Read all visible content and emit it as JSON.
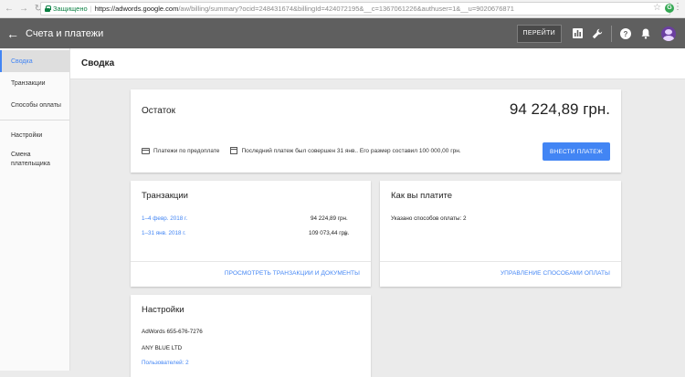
{
  "browser": {
    "secure_label": "Защищено",
    "url_host": "https://adwords.google.com",
    "url_path": "/aw/billing/summary?ocid=248431674&billingId=424072195&__c=1367061226&authuser=1&__u=9020676871",
    "extension_letter": "G"
  },
  "appbar": {
    "title": "Счета и платежи",
    "goto_label": "ПЕРЕЙТИ"
  },
  "sidebar": {
    "items": [
      {
        "label": "Сводка"
      },
      {
        "label": "Транзакции"
      },
      {
        "label": "Способы оплаты"
      },
      {
        "label": "Настройки"
      },
      {
        "label": "Смена плательщика"
      }
    ]
  },
  "page": {
    "title": "Сводка"
  },
  "balance": {
    "label": "Остаток",
    "amount": "94 224,89 грн.",
    "prepay_label": "Платежи по предоплате",
    "last_payment": "Последний платеж был совершен 31 янв.. Его размер составил 100 000,00 грн.",
    "pay_button": "ВНЕСТИ ПЛАТЕЖ"
  },
  "transactions": {
    "title": "Транзакции",
    "rows": [
      {
        "period": "1–4 февр. 2018 г.",
        "amount": "94 224,89 грн."
      },
      {
        "period": "1–31 янв. 2018 г.",
        "amount": "109 073,44 грн."
      }
    ],
    "link": "ПРОСМОТРЕТЬ ТРАНЗАКЦИИ И ДОКУМЕНТЫ"
  },
  "how_pay": {
    "title": "Как вы платите",
    "text": "Указано способов оплаты: 2",
    "link": "УПРАВЛЕНИЕ СПОСОБАМИ ОПЛАТЫ"
  },
  "settings": {
    "title": "Настройки",
    "account": "AdWords 655-676-7276",
    "company": "ANY BLUE LTD",
    "users_link": "Пользователей: 2"
  },
  "colors": {
    "accent": "#4285f4",
    "appbar": "#5f5f5f",
    "secure": "#0b8043"
  }
}
